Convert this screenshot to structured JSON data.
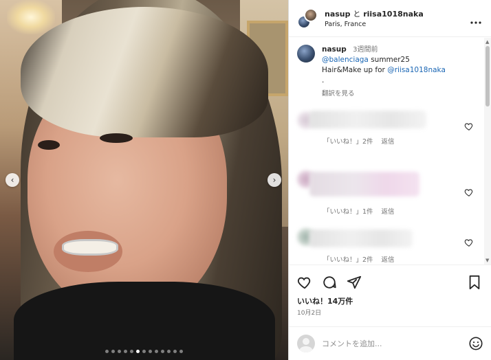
{
  "header": {
    "user1": "nasup",
    "conjunction": "と",
    "user2": "riisa1018naka",
    "location": "Paris, France",
    "more_icon": "more-horizontal-icon"
  },
  "photo": {
    "prev_icon": "‹",
    "next_icon": "›",
    "slide_count": 13,
    "active_slide": 5
  },
  "caption": {
    "username": "nasup",
    "time_ago": "3週間前",
    "mention1": "@balenciaga",
    "text1": " summer25",
    "text2_prefix": "Hair&Make up for ",
    "mention2": "@riisa1018naka",
    "dot_line": ".",
    "translate": "翻訳を見る"
  },
  "comments": [
    {
      "likes": "「いいね！」2件",
      "reply": "返信"
    },
    {
      "likes": "「いいね！」1件",
      "reply": "返信"
    },
    {
      "likes": "「いいね！」2件",
      "reply": "返信"
    }
  ],
  "actions": {
    "like_icon": "heart-icon",
    "comment_icon": "comment-icon",
    "share_icon": "send-icon",
    "save_icon": "bookmark-icon",
    "likes_count": "いいね！14万件",
    "date": "10月2日"
  },
  "composer": {
    "placeholder": "コメントを追加...",
    "emoji_icon": "smile-icon"
  },
  "colors": {
    "text": "#262626",
    "muted": "#737373",
    "link": "#1a66b4",
    "border": "#dbdbdb"
  }
}
